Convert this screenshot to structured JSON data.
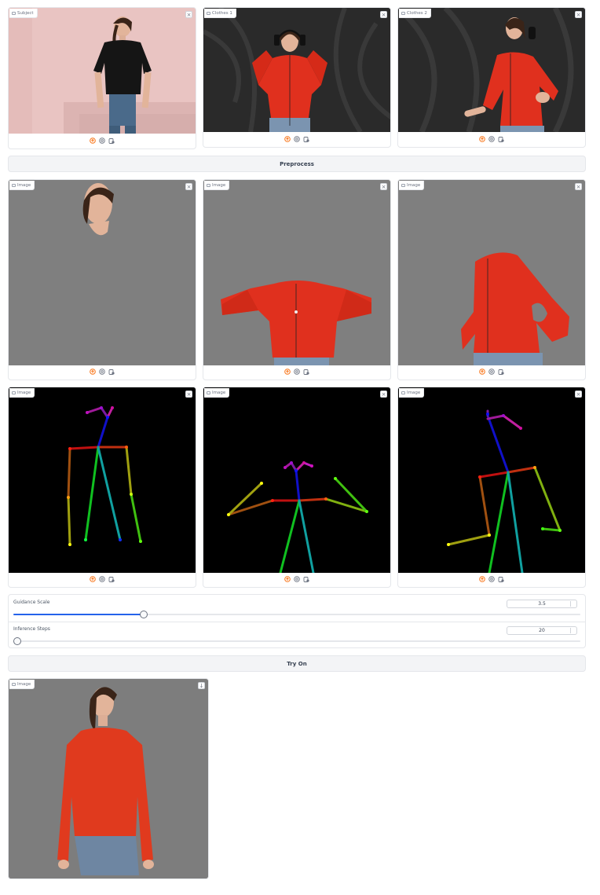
{
  "inputs": {
    "subject_label": "Subject",
    "clothes1_label": "Clothes 1",
    "clothes2_label": "Clothes 2"
  },
  "preprocess_button": "Preprocess",
  "masked": {
    "label1": "Image",
    "label2": "Image",
    "label3": "Image"
  },
  "pose": {
    "label1": "Image",
    "label2": "Image",
    "label3": "Image"
  },
  "controls": {
    "guidance_label": "Guidance Scale",
    "guidance_value": "3.5",
    "guidance_fraction": 0.23,
    "steps_label": "Inference Steps",
    "steps_value": "20",
    "steps_fraction": 0.0
  },
  "tryon_button": "Try On",
  "output": {
    "label": "Image"
  },
  "colors": {
    "accent": "#2563eb",
    "upload_icon": "#f97316",
    "sweater_red": "#e0301e",
    "mask_gray": "#7f7f7f"
  },
  "icons": [
    "image-icon",
    "close-icon",
    "upload-icon",
    "webcam-icon",
    "clipboard-icon",
    "download-icon"
  ]
}
